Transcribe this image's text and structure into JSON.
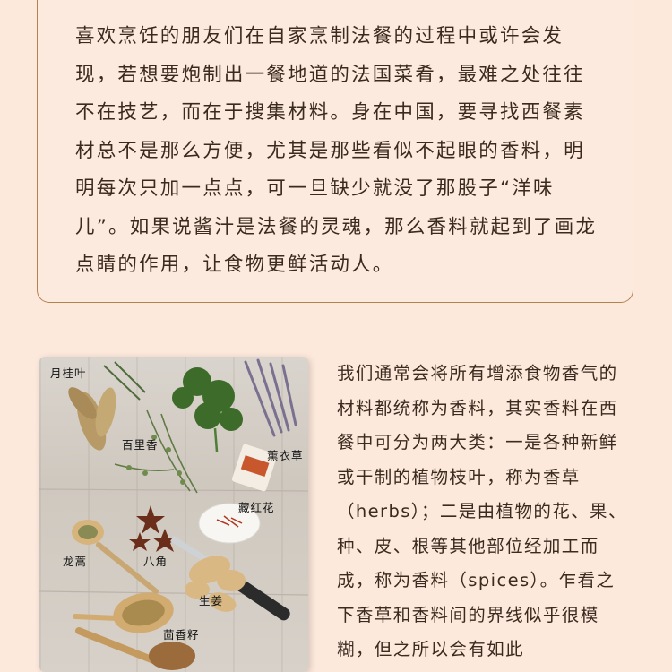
{
  "intro": {
    "text": "喜欢烹饪的朋友们在自家烹制法餐的过程中或许会发现，若想要炮制出一餐地道的法国菜肴，最难之处往往不在技艺，而在于搜集材料。身在中国，要寻找西餐素材总不是那么方便，尤其是那些看似不起眼的香料，明明每次只加一点点，可一旦缺少就没了那股子“洋味儿”。如果说酱汁是法餐的灵魂，那么香料就起到了画龙点睛的作用，让食物更鲜活动人。"
  },
  "photo": {
    "labels": {
      "bay_leaf": "月桂叶",
      "thyme": "百里香",
      "lavender": "薰衣草",
      "saffron": "藏红花",
      "tarragon": "龙蒿",
      "star_anise": "八角",
      "ginger": "生姜",
      "fennel_seed": "茴香籽"
    }
  },
  "body": {
    "text": "我们通常会将所有增添食物香气的材料都统称为香料，其实香料在西餐中可分为两大类：一是各种新鲜或干制的植物枝叶，称为香草（herbs）；二是由植物的花、果、种、皮、根等其他部位经加工而成，称为香料（spices）。乍看之下香草和香料间的界线似乎很模糊，但之所以会有如此"
  }
}
